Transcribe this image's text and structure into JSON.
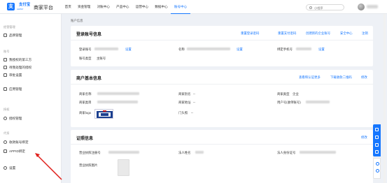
{
  "header": {
    "logo_mark": "支",
    "logo_text": "支付宝",
    "logo_sub": "ALIPAY",
    "platform": "商家平台",
    "nav": [
      "首页",
      "资金管理",
      "对账中心",
      "产品中心",
      "运营中心",
      "数据中心",
      "账号中心"
    ],
    "active_nav": "账号中心",
    "search_placeholder": "小程序"
  },
  "sidebar": {
    "group1": "经营管理",
    "item_brand": "品牌管理",
    "group2": "账号",
    "item_bound": "我授权的第三方",
    "item_apps": "待我处理的授权",
    "item_reports": "审批设置",
    "item_certs": "应用管理",
    "group3": "授权",
    "item_auth": "授权管理",
    "group4": "代扣",
    "item_remit": "收款账号绑定",
    "item_app_id": "APPID绑定",
    "item_settings": "设置"
  },
  "breadcrumb": "账户信息",
  "login_card": {
    "title": "登录账号信息",
    "links": [
      "重置登录密码",
      "重置支付密码",
      "创建新的企业账号",
      "安全中心",
      "注销"
    ],
    "login_account_label": "登录账号",
    "login_account_action": "设置",
    "name_label": "名称",
    "name_action": "设置",
    "phone_label": "绑定手机号",
    "phone_action": "设置",
    "account_type_label": "账号类型",
    "account_type_value": "主账号"
  },
  "merchant_card": {
    "title": "商户基本信息",
    "links": [
      "查看和认证更多",
      "下载收款二维码",
      "修改"
    ],
    "name_label": "商家名称",
    "alias_label": "商家别名",
    "alias_value": "--",
    "type_label": "商家类型",
    "type_value": "企业",
    "short_label": "商家类目",
    "address_label": "商家地址",
    "address_value": "--",
    "pid_label": "用户号(收单账号)",
    "logo_label": "商家logo",
    "mcc_label": "门头照",
    "mcc_value": "--"
  },
  "cert_card": {
    "title": "证照信息",
    "link": "修改",
    "license_no_label": "营业执照注册号",
    "legal_label": "法人姓名",
    "legal_id_label": "法人身份证号",
    "license_img_label": "营业执照图片"
  },
  "colors": {
    "accent": "#1677ff",
    "annotation": "#e0201c"
  }
}
